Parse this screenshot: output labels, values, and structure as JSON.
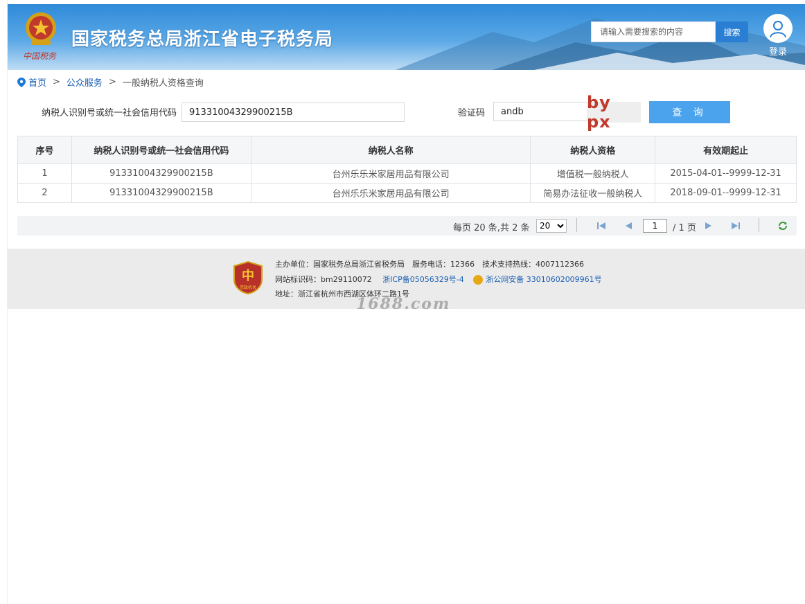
{
  "header": {
    "emblem_sub": "中国税务",
    "title": "国家税务总局浙江省电子税务局",
    "search_placeholder": "请输入需要搜索的内容",
    "search_button": "搜索",
    "login_label": "登录"
  },
  "breadcrumb": {
    "home": "首页",
    "separator": ">",
    "public": "公众服务",
    "current": "一般纳税人资格查询"
  },
  "form": {
    "id_label": "纳税人识别号或统一社会信用代码",
    "id_value": "91331004329900215B",
    "captcha_label": "验证码",
    "captcha_value": "andb",
    "captcha_image_text": "by px",
    "query_button": "查 询"
  },
  "table": {
    "headers": [
      "序号",
      "纳税人识别号或统一社会信用代码",
      "纳税人名称",
      "纳税人资格",
      "有效期起止"
    ],
    "rows": [
      [
        "1",
        "91331004329900215B",
        "台州乐乐米家居用品有限公司",
        "增值税一般纳税人",
        "2015-04-01--9999-12-31"
      ],
      [
        "2",
        "91331004329900215B",
        "台州乐乐米家居用品有限公司",
        "简易办法征收一般纳税人",
        "2018-09-01--9999-12-31"
      ]
    ]
  },
  "pager": {
    "summary": "每页 20 条,共 2 条",
    "page_size": "20",
    "current_page": "1",
    "total_pages": "/ 1 页"
  },
  "footer": {
    "line1": "主办单位：国家税务总局浙江省税务局　服务电话：12366　技术支持热线：4007112366",
    "site_id": "网站标识码：bm29110072",
    "icp": "浙ICP备05056329号-4",
    "police": "浙公网安备 33010602009961号",
    "address": "地址：浙江省杭州市西湖区体环二路1号",
    "badge_text": "党政机关"
  },
  "watermark": "1688.com",
  "colors": {
    "header_blue": "#2f8ad8",
    "link_blue": "#1a5fb4",
    "query_button": "#4aa3ec",
    "captcha_red": "#c0392b"
  }
}
